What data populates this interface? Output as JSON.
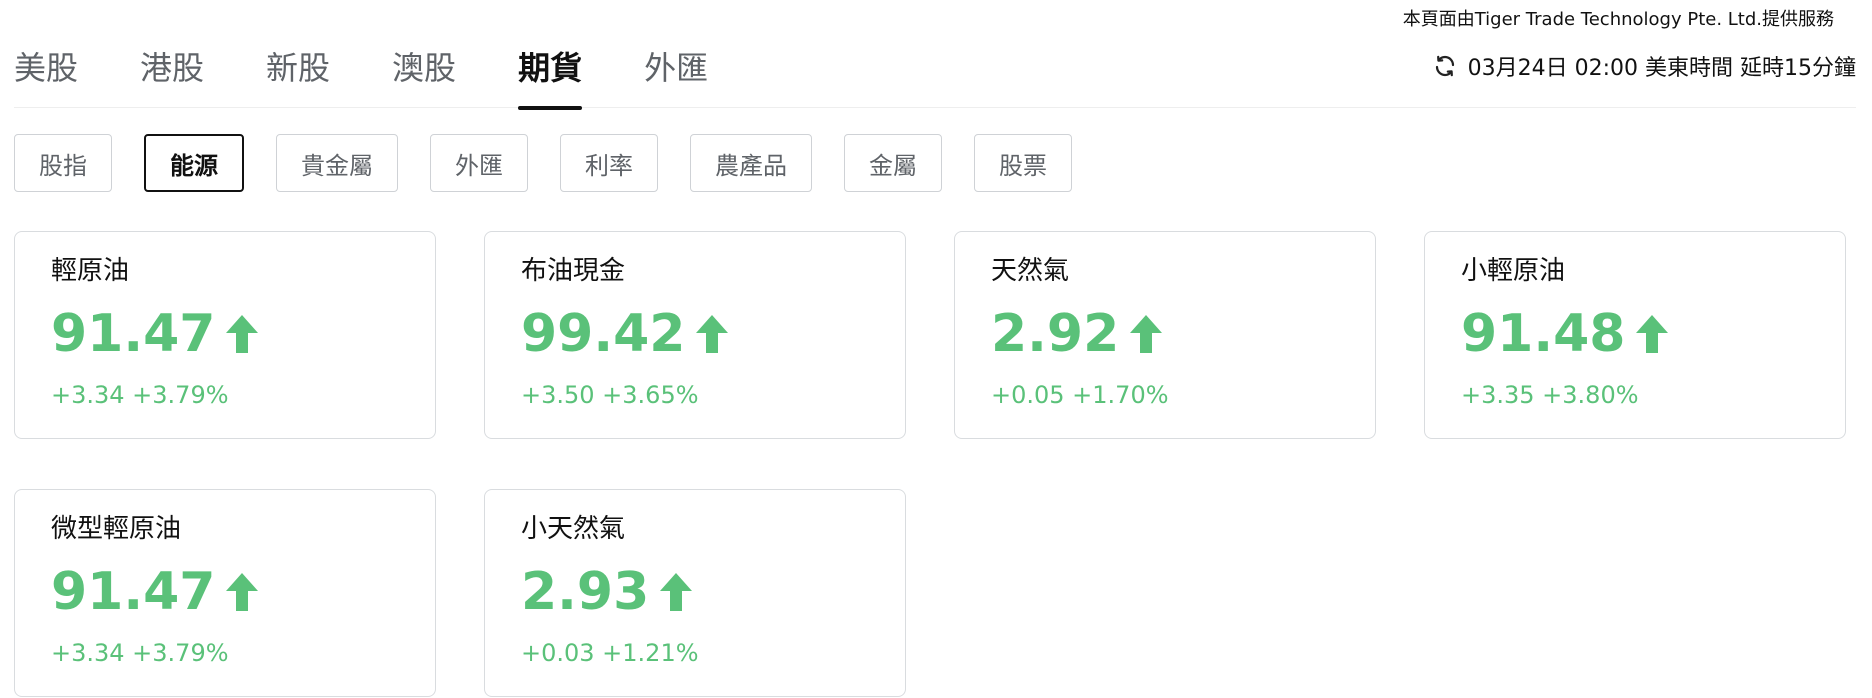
{
  "provider_text": "本頁面由Tiger Trade Technology Pte. Ltd.提供服務",
  "tabs": [
    {
      "label": "美股"
    },
    {
      "label": "港股"
    },
    {
      "label": "新股"
    },
    {
      "label": "澳股"
    },
    {
      "label": "期貨"
    },
    {
      "label": "外匯"
    }
  ],
  "active_tab": "期貨",
  "status": {
    "time_text": "03月24日 02:00 美東時間 延時15分鐘",
    "icon": "refresh-icon"
  },
  "chips": [
    {
      "label": "股指"
    },
    {
      "label": "能源"
    },
    {
      "label": "貴金屬"
    },
    {
      "label": "外匯"
    },
    {
      "label": "利率"
    },
    {
      "label": "農產品"
    },
    {
      "label": "金屬"
    },
    {
      "label": "股票"
    }
  ],
  "active_chip": "能源",
  "cards": [
    {
      "name": "輕原油",
      "price": "91.47",
      "change": "+3.34 +3.79%"
    },
    {
      "name": "布油現金",
      "price": "99.42",
      "change": "+3.50 +3.65%"
    },
    {
      "name": "天然氣",
      "price": "2.92",
      "change": "+0.05 +1.70%"
    },
    {
      "name": "小輕原油",
      "price": "91.48",
      "change": "+3.35 +3.80%"
    },
    {
      "name": "微型輕原油",
      "price": "91.47",
      "change": "+3.34 +3.79%"
    },
    {
      "name": "小天然氣",
      "price": "2.93",
      "change": "+0.03 +1.21%"
    }
  ],
  "colors": {
    "up": "#5ac179",
    "text": "#111111",
    "muted": "#5f6368",
    "border": "#d9dcdf"
  }
}
